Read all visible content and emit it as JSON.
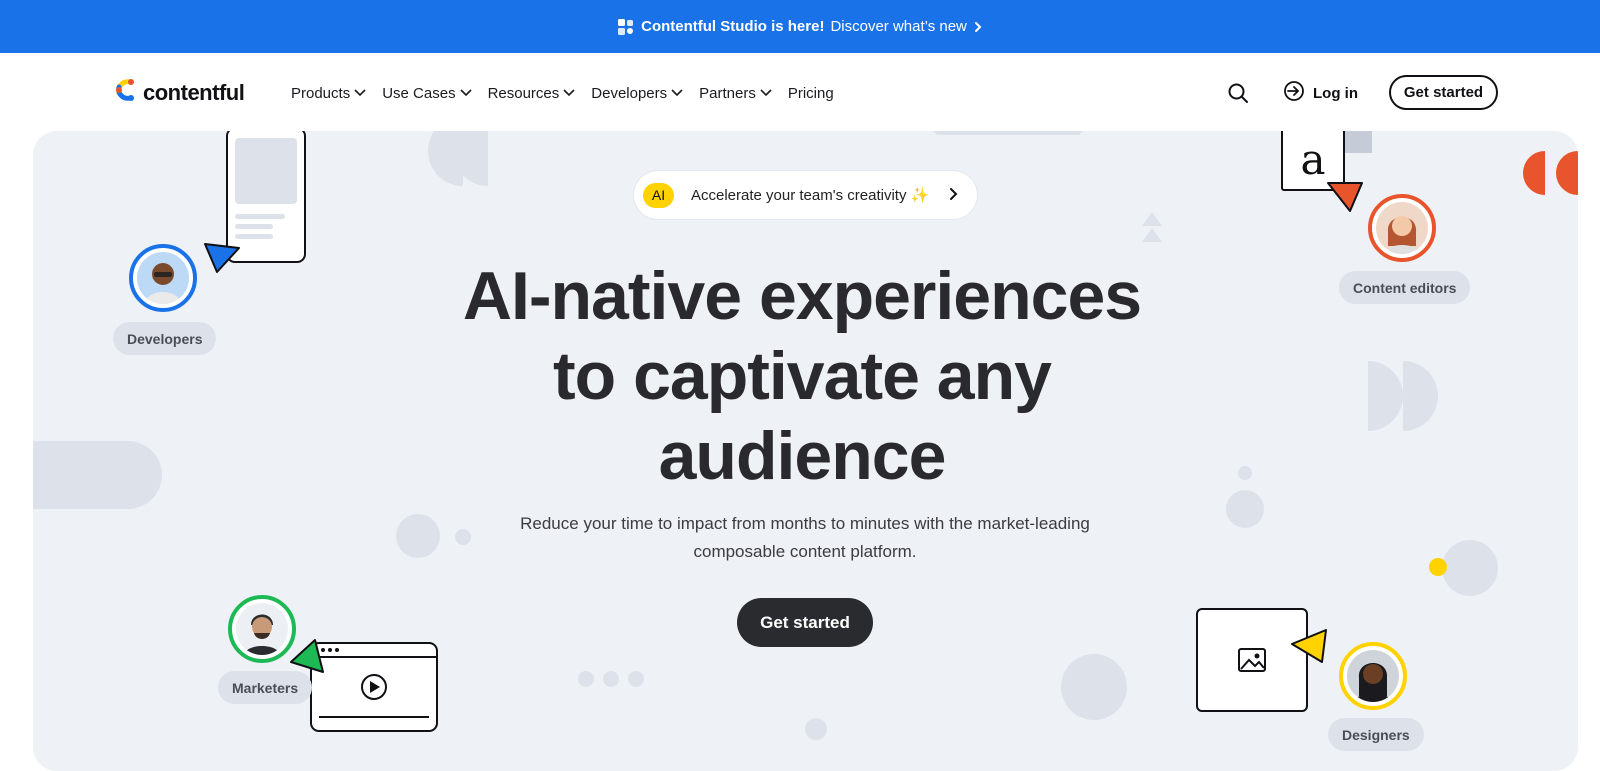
{
  "banner": {
    "title": "Contentful Studio is here!",
    "link": "Discover what’s new",
    "icon": "studio-icon"
  },
  "brand": {
    "name": "contentful",
    "colors": {
      "blue": "#1a72e8",
      "yellow": "#ffd200",
      "red": "#e8542c",
      "green": "#1db954",
      "dark": "#2a2b2f"
    }
  },
  "nav": {
    "items": [
      {
        "label": "Products"
      },
      {
        "label": "Use Cases"
      },
      {
        "label": "Resources"
      },
      {
        "label": "Developers"
      },
      {
        "label": "Partners"
      },
      {
        "label": "Pricing"
      }
    ],
    "login": "Log in",
    "cta": "Get started"
  },
  "hero": {
    "pill_badge": "AI",
    "pill_text": "Accelerate your team's creativity ✨",
    "headline_line1": "AI-native experiences",
    "headline_line2": "to captivate any",
    "headline_line3": "audience",
    "subtitle": "Reduce your time to impact from months to minutes with the market-leading composable content platform.",
    "cta": "Get started",
    "letter_card": "a"
  },
  "roles": [
    {
      "label": "Developers"
    },
    {
      "label": "Content editors"
    },
    {
      "label": "Marketers"
    },
    {
      "label": "Designers"
    }
  ]
}
